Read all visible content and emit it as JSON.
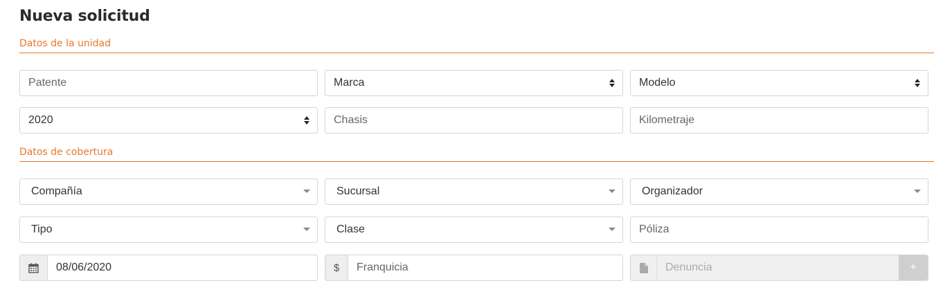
{
  "page": {
    "title": "Nueva solicitud"
  },
  "sections": {
    "unidad": "Datos de la unidad",
    "cobertura": "Datos de cobertura"
  },
  "unidad": {
    "patente_placeholder": "Patente",
    "marca_value": "Marca",
    "modelo_value": "Modelo",
    "anio_value": "2020",
    "chasis_placeholder": "Chasis",
    "kilometraje_placeholder": "Kilometraje"
  },
  "cobertura": {
    "compania_value": "Compañía",
    "sucursal_value": "Sucursal",
    "organizador_value": "Organizador",
    "tipo_value": "Tipo",
    "clase_value": "Clase",
    "poliza_placeholder": "Póliza",
    "fecha_value": "08/06/2020",
    "currency_symbol": "$",
    "franquicia_placeholder": "Franquicia",
    "denuncia_placeholder": "Denuncia",
    "add_label": "+"
  },
  "icons": {
    "calendar": "calendar-icon",
    "file": "file-icon",
    "select_arrows": "sort-arrows-icon",
    "dropdown": "caret-down-icon"
  },
  "colors": {
    "accent": "#e8782a",
    "border": "#d4d4d4",
    "addon_bg": "#eeeeee",
    "disabled_bg": "#f0f0f0",
    "button_disabled": "#cfcfcf"
  }
}
